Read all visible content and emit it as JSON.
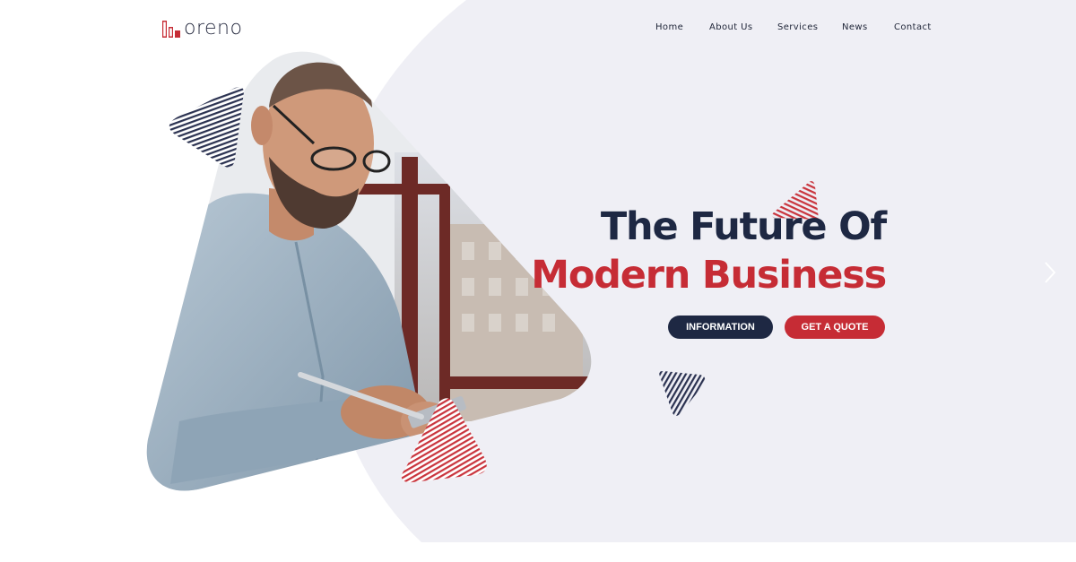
{
  "brand": {
    "name": "oreno",
    "colors": {
      "primary_dark": "#1e2843",
      "accent_red": "#c62c35",
      "panel_bg": "#efeff5"
    }
  },
  "nav": {
    "items": [
      {
        "label": "Home"
      },
      {
        "label": "About Us"
      },
      {
        "label": "Services"
      },
      {
        "label": "News"
      },
      {
        "label": "Contact"
      }
    ]
  },
  "hero": {
    "title_line1": "The Future Of",
    "title_line2": "Modern Business",
    "buttons": {
      "information": "INFORMATION",
      "quote": "GET A QUOTE"
    },
    "photo_icon": "person-photo",
    "next_icon": "chevron-right-icon"
  }
}
